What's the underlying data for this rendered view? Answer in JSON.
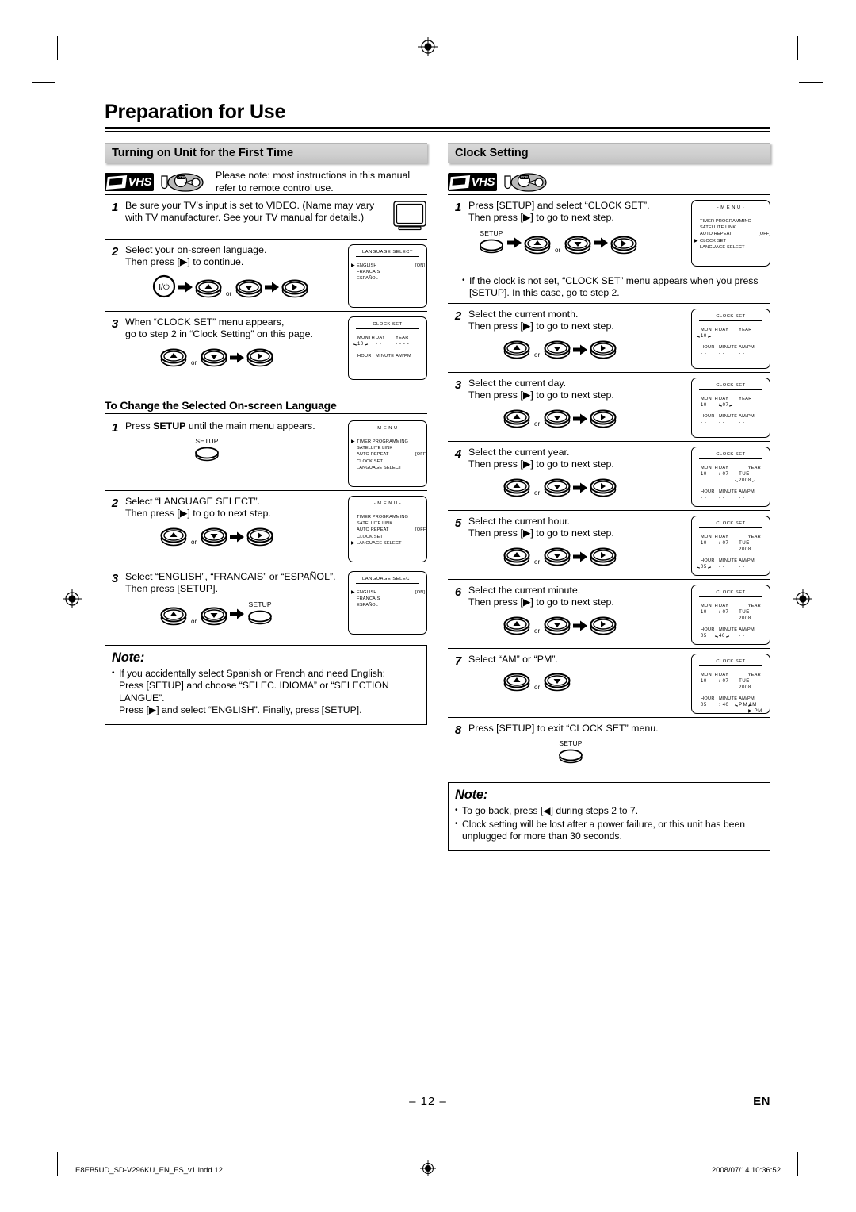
{
  "page": {
    "chapter_title": "Preparation for Use",
    "page_number": "– 12 –",
    "lang_mark": "EN",
    "footer_file": "E8EB5UD_SD-V296KU_EN_ES_v1.indd   12",
    "footer_timestamp": "2008/07/14   10:36:52"
  },
  "badges": {
    "vhs": "VHS",
    "vcr": "VCR"
  },
  "left": {
    "section_title": "Turning on Unit for the First Time",
    "intro": "Please note: most instructions in this manual refer to remote control use.",
    "steps": [
      {
        "num": "1",
        "text": "Be sure your TV’s input is set to VIDEO. (Name may vary with TV manufacturer. See your TV manual for details.)",
        "aside": "tv-icon"
      },
      {
        "num": "2",
        "text": "Select your on-screen language.\nThen press [▶] to continue.",
        "keys": [
          "power",
          "up",
          "or",
          "down",
          "right"
        ],
        "osd": "language_select_english"
      },
      {
        "num": "3",
        "text": "When “CLOCK SET” menu appears,\ngo to step 2 in “Clock Setting” on this page.",
        "keys": [
          "up",
          "or",
          "down",
          "right"
        ],
        "osd": "clock_set_month_blank"
      }
    ],
    "subsection_title": "To Change the Selected On-screen Language",
    "lang_steps": [
      {
        "num": "1",
        "text": "Press [SETUP] until the main menu appears.",
        "keys": [
          "setup"
        ],
        "osd": "menu_timer_selected"
      },
      {
        "num": "2",
        "text": "Select “LANGUAGE SELECT”.\nThen press [▶] to go to next step.",
        "keys": [
          "up",
          "or",
          "down",
          "right"
        ],
        "osd": "menu_language_selected"
      },
      {
        "num": "3",
        "text": "Select “ENGLISH”, “FRANCAIS” or “ESPAÑOL”. Then press [SETUP].",
        "keys": [
          "up",
          "or",
          "down",
          "setup"
        ],
        "osd": "language_select_english"
      }
    ],
    "note": {
      "heading": "Note:",
      "items": [
        "If you accidentally select Spanish or French and need English:",
        "Press [SETUP] and choose “SELEC. IDIOMA” or “SELECTION LANGUE”.",
        "Press [▶] and select “ENGLISH”. Finally, press [SETUP]."
      ]
    }
  },
  "right": {
    "section_title": "Clock Setting",
    "steps": [
      {
        "num": "1",
        "text": "Press [SETUP] and select “CLOCK SET”.\nThen press [▶] to go to next step.",
        "keys": [
          "setup",
          "up",
          "or",
          "down",
          "right"
        ],
        "osd": "menu_clock_selected"
      },
      {
        "num": "2",
        "text": "Select the current month.\nThen press [▶] to go to next step.",
        "keys": [
          "up",
          "or",
          "down",
          "right"
        ],
        "osd": "clock_month"
      },
      {
        "num": "3",
        "text": "Select the current day.\nThen press [▶] to go to next step.",
        "keys": [
          "up",
          "or",
          "down",
          "right"
        ],
        "osd": "clock_day"
      },
      {
        "num": "4",
        "text": "Select the current year.\nThen press [▶] to go to next step.",
        "keys": [
          "up",
          "or",
          "down",
          "right"
        ],
        "osd": "clock_year"
      },
      {
        "num": "5",
        "text": "Select the current hour.\nThen press [▶] to go to next step.",
        "keys": [
          "up",
          "or",
          "down",
          "right"
        ],
        "osd": "clock_hour"
      },
      {
        "num": "6",
        "text": "Select the current minute.\nThen press [▶] to go to next step.",
        "keys": [
          "up",
          "or",
          "down",
          "right"
        ],
        "osd": "clock_minute"
      },
      {
        "num": "7",
        "text": "Select “AM” or “PM”.",
        "keys": [
          "up",
          "or",
          "down"
        ],
        "osd": "clock_ampm"
      },
      {
        "num": "8",
        "text": "Press [SETUP] to exit “CLOCK SET” menu.",
        "keys": [
          "setup"
        ],
        "osd": null
      }
    ],
    "bullet_after_step1": "If the clock is not set, “CLOCK SET” menu appears when you press [SETUP]. In this case, go to step 2.",
    "note": {
      "heading": "Note:",
      "items": [
        "To go back, press [◀] during steps 2 to 7.",
        "Clock setting will be lost after a power failure, or this unit has been unplugged for more than 30 seconds."
      ]
    }
  },
  "osd_screens": {
    "menu": {
      "title": "- M E N U -",
      "items": [
        {
          "label": "TIMER PROGRAMMING",
          "value": ""
        },
        {
          "label": "SATELLITE LINK",
          "value": ""
        },
        {
          "label": "AUTO REPEAT",
          "value": "[OFF]"
        },
        {
          "label": "CLOCK SET",
          "value": ""
        },
        {
          "label": "LANGUAGE SELECT",
          "value": ""
        }
      ]
    },
    "language_select": {
      "title": "LANGUAGE SELECT",
      "items": [
        {
          "label": "ENGLISH",
          "value": "[ON]"
        },
        {
          "label": "FRANCAIS",
          "value": ""
        },
        {
          "label": "ESPAÑOL",
          "value": ""
        }
      ]
    },
    "clock_set": {
      "title": "CLOCK SET",
      "labels": {
        "month": "MONTH",
        "day": "DAY",
        "year": "YEAR",
        "hour": "HOUR",
        "minute": "MINUTE",
        "ampm": "AM/PM",
        "slash": "/",
        "colon": ":",
        "weekday": "TUE",
        "am": "AM",
        "pm": "PM"
      },
      "blank": "- -",
      "blank_year": "- - - -",
      "values": {
        "month": "10",
        "day": "07",
        "year": "2008",
        "hour": "05",
        "minute": "40"
      }
    }
  },
  "keys": {
    "power": "I/⏻",
    "up": "▲",
    "down": "▼",
    "right": "▶",
    "or": "or",
    "setup": "SETUP"
  }
}
